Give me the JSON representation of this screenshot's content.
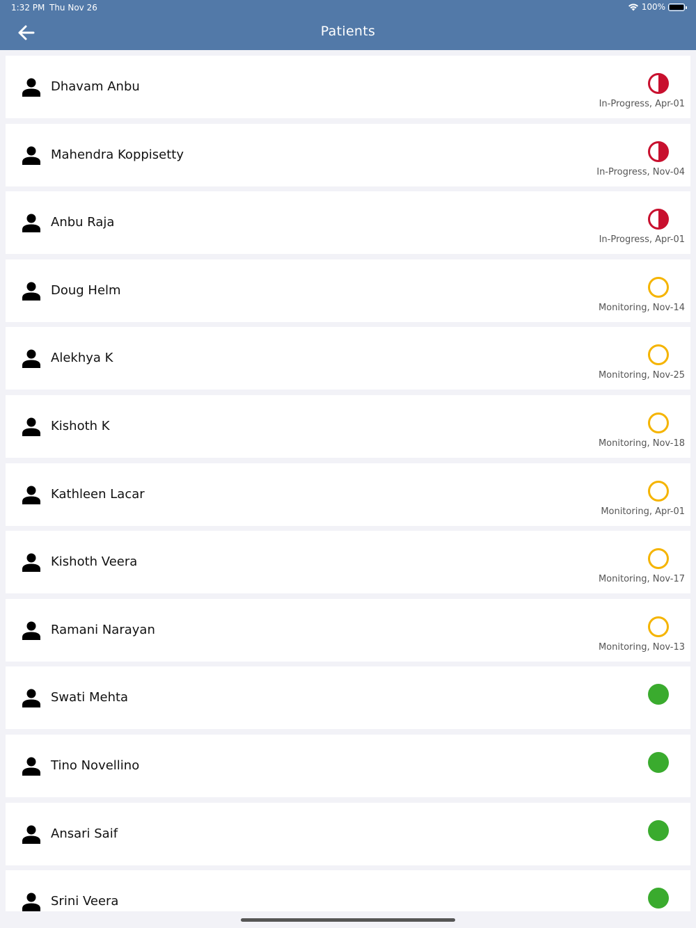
{
  "status_bar": {
    "time": "1:32 PM",
    "date": "Thu Nov 26",
    "battery": "100%"
  },
  "header": {
    "title": "Patients",
    "back_icon": "arrow-left-icon"
  },
  "colors": {
    "header_bg": "#5279a8",
    "in_progress": "#c8102e",
    "monitoring": "#f5b400",
    "complete": "#3aab2e"
  },
  "patients": [
    {
      "name": "Dhavam Anbu",
      "status": "in-progress",
      "label": "In-Progress, Apr-01"
    },
    {
      "name": "Mahendra Koppisetty",
      "status": "in-progress",
      "label": "In-Progress, Nov-04"
    },
    {
      "name": "Anbu Raja",
      "status": "in-progress",
      "label": "In-Progress, Apr-01"
    },
    {
      "name": "Doug Helm",
      "status": "monitoring",
      "label": "Monitoring, Nov-14"
    },
    {
      "name": "Alekhya K",
      "status": "monitoring",
      "label": "Monitoring, Nov-25"
    },
    {
      "name": "Kishoth K",
      "status": "monitoring",
      "label": "Monitoring, Nov-18"
    },
    {
      "name": "Kathleen Lacar",
      "status": "monitoring",
      "label": "Monitoring, Apr-01"
    },
    {
      "name": "Kishoth  Veera",
      "status": "monitoring",
      "label": "Monitoring, Nov-17"
    },
    {
      "name": "Ramani Narayan",
      "status": "monitoring",
      "label": "Monitoring, Nov-13"
    },
    {
      "name": "Swati Mehta",
      "status": "complete",
      "label": ""
    },
    {
      "name": "Tino Novellino",
      "status": "complete",
      "label": ""
    },
    {
      "name": "Ansari Saif",
      "status": "complete",
      "label": ""
    },
    {
      "name": "Srini Veera",
      "status": "complete",
      "label": ""
    }
  ]
}
